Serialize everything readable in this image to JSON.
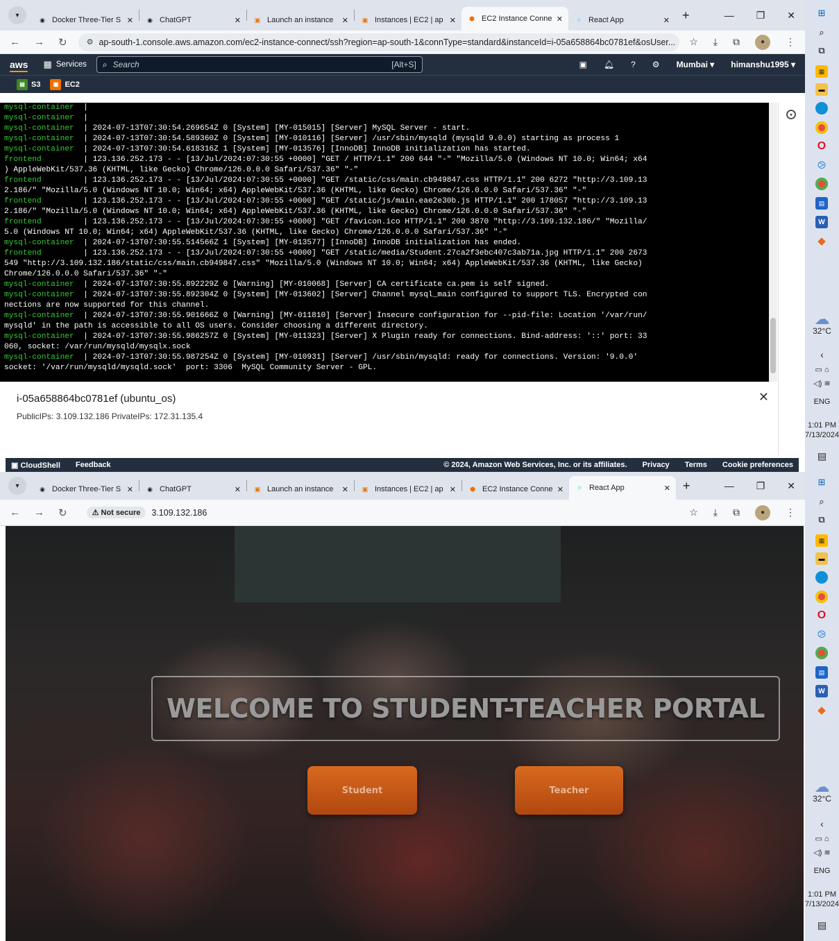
{
  "browser": {
    "tabs": [
      {
        "title": "Docker Three-Tier S",
        "icon": "github-icon",
        "color": "#1b1f23"
      },
      {
        "title": "ChatGPT",
        "icon": "chatgpt-icon",
        "color": "#1b1f23"
      },
      {
        "title": "Launch an instance",
        "icon": "aws-ec2-icon",
        "color": "#ed7100"
      },
      {
        "title": "Instances | EC2 | ap",
        "icon": "aws-ec2-icon",
        "color": "#ed7100"
      },
      {
        "title": "EC2 Instance Conne",
        "icon": "aws-hexagon-icon",
        "color": "#ed7100"
      },
      {
        "title": "React App",
        "icon": "react-icon",
        "color": "#61dafb"
      }
    ]
  },
  "window1": {
    "active_tab": 4,
    "url": "ap-south-1.console.aws.amazon.com/ec2-instance-connect/ssh?region=ap-south-1&connType=standard&instanceId=i-05a658864bc0781ef&osUser...",
    "aws_nav": {
      "logo": "aws",
      "services_label": "Services",
      "search_placeholder": "Search",
      "search_shortcut": "[Alt+S]",
      "region": "Mumbai ▾",
      "user": "himanshu1995 ▾"
    },
    "favorites": [
      {
        "label": "S3",
        "color": "#3f8624"
      },
      {
        "label": "EC2",
        "color": "#ed7100"
      }
    ],
    "terminal_lines": [
      {
        "container": "mysql-container",
        "text": "  |"
      },
      {
        "container": "mysql-container",
        "text": "  |"
      },
      {
        "container": "mysql-container",
        "text": "  | 2024-07-13T07:30:54.269654Z 0 [System] [MY-015015] [Server] MySQL Server - start."
      },
      {
        "container": "mysql-container",
        "text": "  | 2024-07-13T07:30:54.589360Z 0 [System] [MY-010116] [Server] /usr/sbin/mysqld (mysqld 9.0.0) starting as process 1"
      },
      {
        "container": "mysql-container",
        "text": "  | 2024-07-13T07:30:54.618316Z 1 [System] [MY-013576] [InnoDB] InnoDB initialization has started."
      },
      {
        "container": "frontend",
        "text": "         | 123.136.252.173 - - [13/Jul/2024:07:30:55 +0000] \"GET / HTTP/1.1\" 200 644 \"-\" \"Mozilla/5.0 (Windows NT 10.0; Win64; x64"
      },
      {
        "container": "",
        "text": ") AppleWebKit/537.36 (KHTML, like Gecko) Chrome/126.0.0.0 Safari/537.36\" \"-\""
      },
      {
        "container": "frontend",
        "text": "         | 123.136.252.173 - - [13/Jul/2024:07:30:55 +0000] \"GET /static/css/main.cb949847.css HTTP/1.1\" 200 6272 \"http://3.109.13"
      },
      {
        "container": "",
        "text": "2.186/\" \"Mozilla/5.0 (Windows NT 10.0; Win64; x64) AppleWebKit/537.36 (KHTML, like Gecko) Chrome/126.0.0.0 Safari/537.36\" \"-\""
      },
      {
        "container": "frontend",
        "text": "         | 123.136.252.173 - - [13/Jul/2024:07:30:55 +0000] \"GET /static/js/main.eae2e30b.js HTTP/1.1\" 200 178057 \"http://3.109.13"
      },
      {
        "container": "",
        "text": "2.186/\" \"Mozilla/5.0 (Windows NT 10.0; Win64; x64) AppleWebKit/537.36 (KHTML, like Gecko) Chrome/126.0.0.0 Safari/537.36\" \"-\""
      },
      {
        "container": "frontend",
        "text": "         | 123.136.252.173 - - [13/Jul/2024:07:30:55 +0000] \"GET /favicon.ico HTTP/1.1\" 200 3870 \"http://3.109.132.186/\" \"Mozilla/"
      },
      {
        "container": "",
        "text": "5.0 (Windows NT 10.0; Win64; x64) AppleWebKit/537.36 (KHTML, like Gecko) Chrome/126.0.0.0 Safari/537.36\" \"-\""
      },
      {
        "container": "mysql-container",
        "text": "  | 2024-07-13T07:30:55.514566Z 1 [System] [MY-013577] [InnoDB] InnoDB initialization has ended."
      },
      {
        "container": "frontend",
        "text": "         | 123.136.252.173 - - [13/Jul/2024:07:30:55 +0000] \"GET /static/media/Student.27ca2f3ebc407c3ab71a.jpg HTTP/1.1\" 200 2673"
      },
      {
        "container": "",
        "text": "549 \"http://3.109.132.186/static/css/main.cb949847.css\" \"Mozilla/5.0 (Windows NT 10.0; Win64; x64) AppleWebKit/537.36 (KHTML, like Gecko)"
      },
      {
        "container": "",
        "text": "Chrome/126.0.0.0 Safari/537.36\" \"-\""
      },
      {
        "container": "mysql-container",
        "text": "  | 2024-07-13T07:30:55.892229Z 0 [Warning] [MY-010068] [Server] CA certificate ca.pem is self signed."
      },
      {
        "container": "mysql-container",
        "text": "  | 2024-07-13T07:30:55.892304Z 0 [System] [MY-013602] [Server] Channel mysql_main configured to support TLS. Encrypted con"
      },
      {
        "container": "",
        "text": "nections are now supported for this channel."
      },
      {
        "container": "mysql-container",
        "text": "  | 2024-07-13T07:30:55.901666Z 0 [Warning] [MY-011810] [Server] Insecure configuration for --pid-file: Location '/var/run/"
      },
      {
        "container": "",
        "text": "mysqld' in the path is accessible to all OS users. Consider choosing a different directory."
      },
      {
        "container": "mysql-container",
        "text": "  | 2024-07-13T07:30:55.986257Z 0 [System] [MY-011323] [Server] X Plugin ready for connections. Bind-address: '::' port: 33"
      },
      {
        "container": "",
        "text": "060, socket: /var/run/mysqld/mysqlx.sock"
      },
      {
        "container": "mysql-container",
        "text": "  | 2024-07-13T07:30:55.987254Z 0 [System] [MY-010931] [Server] /usr/sbin/mysqld: ready for connections. Version: '9.0.0'"
      },
      {
        "container": "",
        "text": "socket: '/var/run/mysqld/mysqld.sock'  port: 3306  MySQL Community Server - GPL."
      }
    ],
    "instance": {
      "title": "i-05a658864bc0781ef (ubuntu_os)",
      "ips": "PublicIPs: 3.109.132.186   PrivateIPs: 172.31.135.4"
    },
    "footer": {
      "cloudshell": "CloudShell",
      "feedback": "Feedback",
      "copyright": "© 2024, Amazon Web Services, Inc. or its affiliates.",
      "privacy": "Privacy",
      "terms": "Terms",
      "cookies": "Cookie preferences"
    }
  },
  "window2": {
    "active_tab": 5,
    "security": "Not secure",
    "url": "3.109.132.186",
    "hero": {
      "heading": "WELCOME TO STUDENT-TEACHER PORTAL",
      "student_button": "Student",
      "teacher_button": "Teacher"
    }
  },
  "taskbar": {
    "temperature": "32°C",
    "language": "ENG",
    "time": "1:01 PM",
    "date": "7/13/2024"
  }
}
